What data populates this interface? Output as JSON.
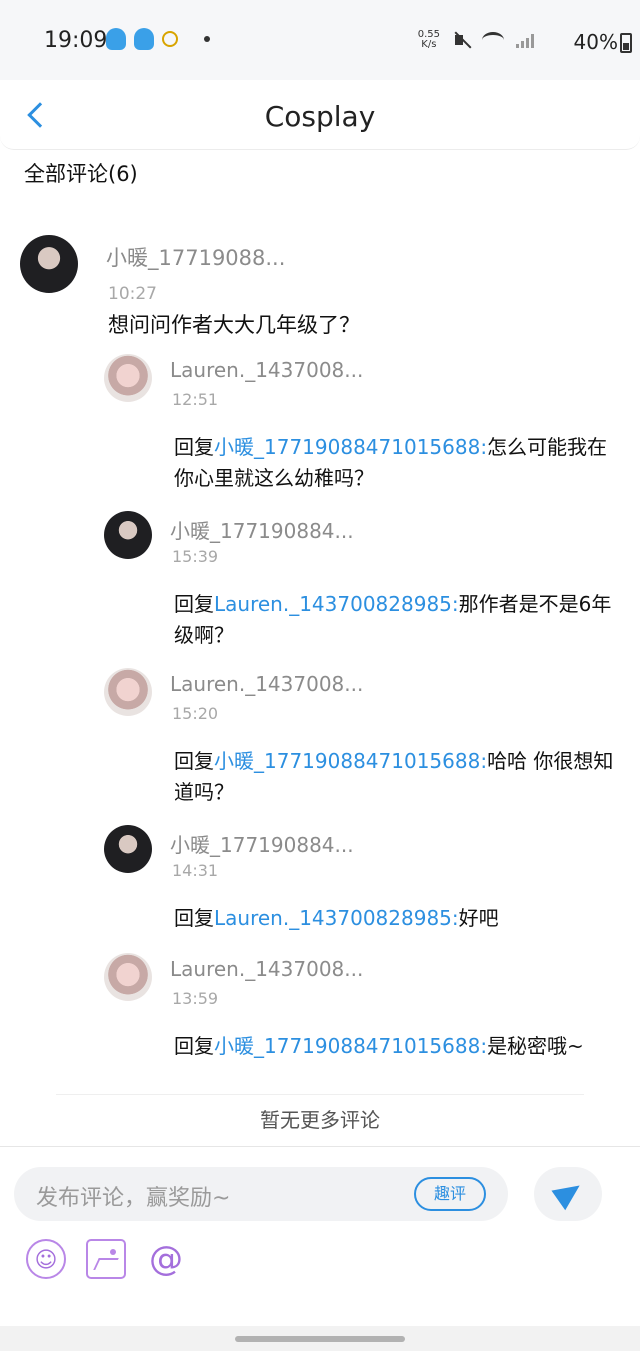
{
  "status": {
    "time": "19:09",
    "speed_top": "0.55",
    "speed_bottom": "K/s",
    "battery": "40%"
  },
  "header": {
    "title": "Cosplay"
  },
  "comments": {
    "section_title": "全部评论(6)",
    "main": {
      "name": "小暖_17719088...",
      "time": "10:27",
      "text": "想问问作者大大几年级了？"
    },
    "replies": [
      {
        "name": "Lauren._1437008...",
        "time": "12:51",
        "prefix": "回复",
        "mention": "小暖_17719088471015688:",
        "text": "怎么可能我在你心里就这么幼稚吗？"
      },
      {
        "name": "小暖_177190884...",
        "time": "15:39",
        "prefix": "回复",
        "mention": "Lauren._143700828985:",
        "text": "那作者是不是6年级啊？"
      },
      {
        "name": "Lauren._1437008...",
        "time": "15:20",
        "prefix": "回复",
        "mention": "小暖_17719088471015688:",
        "text": "哈哈 你很想知道吗？"
      },
      {
        "name": "小暖_177190884...",
        "time": "14:31",
        "prefix": "回复",
        "mention": "Lauren._143700828985:",
        "text": "好吧"
      },
      {
        "name": "Lauren._1437008...",
        "time": "13:59",
        "prefix": "回复",
        "mention": "小暖_17719088471015688:",
        "text": "是秘密哦~"
      }
    ],
    "footer": "暂无更多评论"
  },
  "composer": {
    "placeholder": "发布评论，赢奖励~",
    "quick_reply": "趣评",
    "icons": [
      "emoji-icon",
      "image-icon",
      "at-icon"
    ]
  },
  "colors": {
    "accent": "#2c8fe0",
    "tool_purple": "#a46fdc"
  }
}
